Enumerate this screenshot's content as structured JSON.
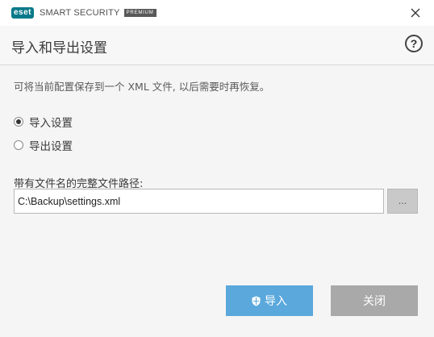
{
  "titlebar": {
    "logo_text": "eset",
    "product_name": "SMART SECURITY",
    "edition": "PREMIUM"
  },
  "header": {
    "title": "导入和导出设置",
    "help_glyph": "?"
  },
  "main": {
    "description": "可将当前配置保存到一个 XML 文件, 以后需要时再恢复。",
    "options": [
      {
        "label": "导入设置",
        "selected": true
      },
      {
        "label": "导出设置",
        "selected": false
      }
    ],
    "path_label": "带有文件名的完整文件路径:",
    "path_value": "C:\\Backup\\settings.xml",
    "browse_label": "..."
  },
  "footer": {
    "import_label": "导入",
    "close_label": "关闭"
  },
  "colors": {
    "primary_button": "#5aa8dc",
    "secondary_button": "#a9a9a9",
    "logo": "#0a7a8a"
  },
  "icons": [
    "close-icon",
    "help-icon",
    "shield-icon"
  ]
}
